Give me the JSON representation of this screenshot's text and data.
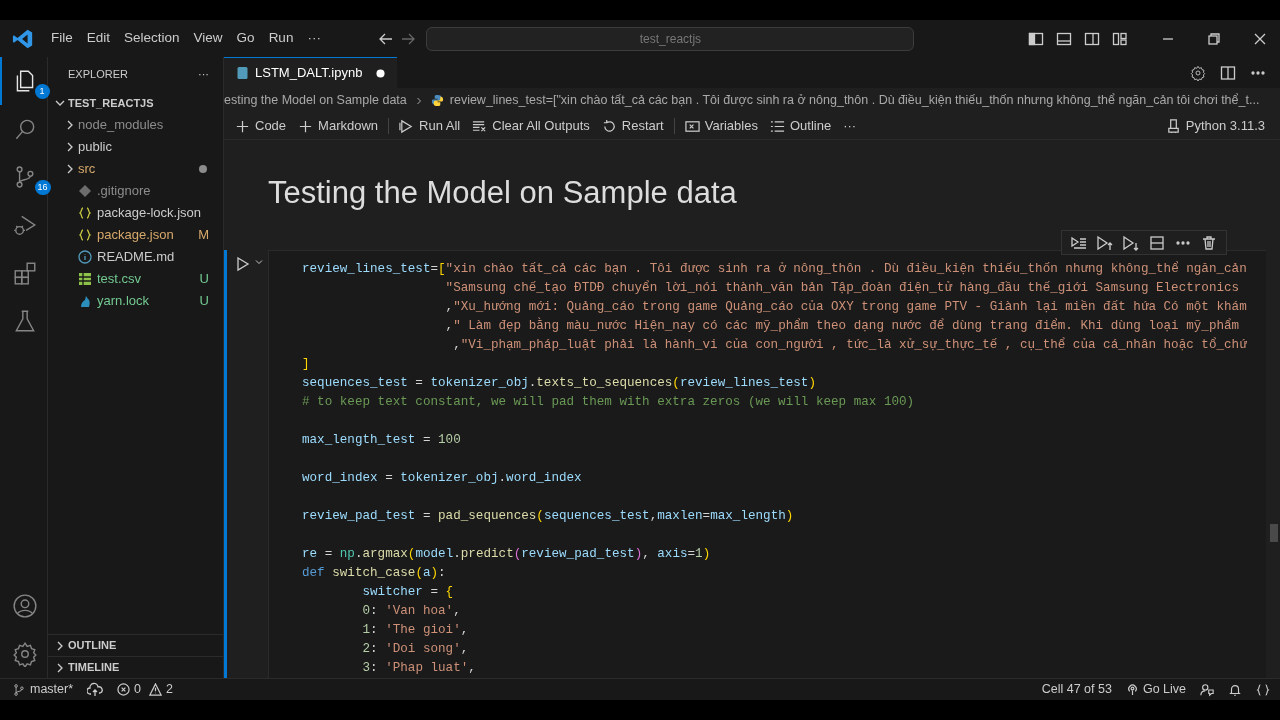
{
  "title_bar": {
    "menu": [
      "File",
      "Edit",
      "Selection",
      "View",
      "Go",
      "Run",
      "···"
    ],
    "command_center": "test_reactjs"
  },
  "activity_bar": {
    "items": [
      {
        "badge": "1",
        "selected": true
      },
      {
        "selected": false
      },
      {
        "badge": "16",
        "selected": false
      },
      {
        "selected": false
      },
      {
        "selected": false
      },
      {
        "selected": false
      }
    ]
  },
  "sidebar": {
    "title": "EXPLORER",
    "more": "···",
    "root": {
      "label": "TEST_REACTJS",
      "expanded": true,
      "children": [
        {
          "kind": "folder",
          "label": "node_modules",
          "expanded": false,
          "color": "#8c8c8c"
        },
        {
          "kind": "folder",
          "label": "public",
          "expanded": false,
          "color": "#cccccc"
        },
        {
          "kind": "folder",
          "label": "src",
          "expanded": false,
          "color": "#d7a96b",
          "status_dot": true
        },
        {
          "kind": "ignore",
          "label": ".gitignore",
          "color": "#8c8c8c"
        },
        {
          "kind": "json",
          "label": "package-lock.json",
          "color": "#cccccc"
        },
        {
          "kind": "json",
          "label": "package.json",
          "color": "#d7a96b",
          "status": "M"
        },
        {
          "kind": "info",
          "label": "README.md",
          "color": "#cccccc"
        },
        {
          "kind": "table",
          "label": "test.csv",
          "color": "#73c991",
          "status": "U"
        },
        {
          "kind": "lock",
          "label": "yarn.lock",
          "color": "#73c991",
          "status": "U"
        }
      ]
    },
    "sections": [
      {
        "label": "OUTLINE",
        "expanded": false
      },
      {
        "label": "TIMELINE",
        "expanded": false
      }
    ]
  },
  "editor": {
    "tabs": [
      {
        "label": "LSTM_DALT.ipynb",
        "selected": true,
        "dirty": true
      }
    ],
    "breadcrumb": [
      "esting the Model on Sample data",
      "review_lines_test=[\"xin chào tất_cả các bạn . Tôi được sinh ra ở nông_thôn . Dù điều_kiện thiếu_thốn nhưng không_thể ngăn_cản tôi chơi thể_t..."
    ],
    "toolbar": [
      {
        "kind": "add",
        "label": "Code"
      },
      {
        "kind": "add",
        "label": "Markdown",
        "separator_after": true
      },
      {
        "kind": "run",
        "label": "Run All"
      },
      {
        "kind": "clear",
        "label": "Clear All Outputs"
      },
      {
        "kind": "restart",
        "label": "Restart",
        "separator_after": true
      },
      {
        "kind": "variables",
        "label": "Variables"
      },
      {
        "kind": "outline",
        "label": "Outline"
      },
      {
        "kind": "more",
        "label": "···"
      }
    ],
    "kernel": "Python 3.11.3",
    "heading": "Testing the Model on Sample data",
    "cell": {
      "focused": true,
      "lines": [
        {
          "kind": "code",
          "tokens": [
            {
              "kind": "var",
              "text": "review_lines_test"
            },
            {
              "kind": "plain",
              "text": "="
            },
            {
              "kind": "bracket",
              "text": "["
            },
            {
              "kind": "str",
              "text": "\"xin chào tất_cả các bạn . Tôi được sinh ra ở nông_thôn . Dù điều_kiện thiếu_thốn nhưng không_thể ngăn_cản"
            }
          ]
        },
        {
          "kind": "code",
          "tokens": [
            {
              "kind": "str",
              "text": "                   \"Samsung chế_tạo ĐTDĐ chuyển lời_nói thành_văn bản Tập_đoàn điện_tử hàng_đầu thế_giới Samsung Electronics"
            }
          ]
        },
        {
          "kind": "code",
          "tokens": [
            {
              "kind": "plain",
              "text": "                   ,"
            },
            {
              "kind": "str",
              "text": "\"Xu_hướng mới: Quảng_cáo trong game Quảng_cáo của OXY trong game PTV - Giành lại miền đất hứa Có một khám"
            }
          ]
        },
        {
          "kind": "code",
          "tokens": [
            {
              "kind": "plain",
              "text": "                   ,"
            },
            {
              "kind": "str",
              "text": "\" Làm đẹp bằng màu_nước Hiện_nay có các mỹ_phẩm theo dạng nước để dùng trang điểm. Khi dùng loại mỹ_phẩm"
            }
          ]
        },
        {
          "kind": "code",
          "tokens": [
            {
              "kind": "plain",
              "text": "                    ,"
            },
            {
              "kind": "str",
              "text": "\"Vi_phạm_pháp_luật phải là hành_vi của con_người , tức_là xử_sự_thực_tế , cụ_thể của cá_nhân hoặc tổ_chứ"
            }
          ]
        },
        {
          "kind": "code",
          "tokens": [
            {
              "kind": "bracket",
              "text": "]"
            }
          ]
        },
        {
          "kind": "code",
          "tokens": [
            {
              "kind": "var",
              "text": "sequences_test"
            },
            {
              "kind": "plain",
              "text": " = "
            },
            {
              "kind": "var",
              "text": "tokenizer_obj"
            },
            {
              "kind": "plain",
              "text": "."
            },
            {
              "kind": "fn",
              "text": "texts_to_sequences"
            },
            {
              "kind": "bracket",
              "text": "("
            },
            {
              "kind": "var",
              "text": "review_lines_test"
            },
            {
              "kind": "bracket",
              "text": ")"
            }
          ]
        },
        {
          "kind": "code",
          "tokens": [
            {
              "kind": "comment",
              "text": "# to keep text constant, we will pad them with extra zeros (we will keep max 100)"
            }
          ]
        },
        {
          "kind": "blank"
        },
        {
          "kind": "code",
          "tokens": [
            {
              "kind": "var",
              "text": "max_length_test"
            },
            {
              "kind": "plain",
              "text": " = "
            },
            {
              "kind": "num",
              "text": "100"
            }
          ]
        },
        {
          "kind": "blank"
        },
        {
          "kind": "code",
          "tokens": [
            {
              "kind": "var",
              "text": "word_index"
            },
            {
              "kind": "plain",
              "text": " = "
            },
            {
              "kind": "var",
              "text": "tokenizer_obj"
            },
            {
              "kind": "plain",
              "text": "."
            },
            {
              "kind": "var",
              "text": "word_index"
            }
          ]
        },
        {
          "kind": "blank"
        },
        {
          "kind": "code",
          "tokens": [
            {
              "kind": "var",
              "text": "review_pad_test"
            },
            {
              "kind": "plain",
              "text": " = "
            },
            {
              "kind": "fn",
              "text": "pad_sequences"
            },
            {
              "kind": "bracket",
              "text": "("
            },
            {
              "kind": "var",
              "text": "sequences_test"
            },
            {
              "kind": "plain",
              "text": ","
            },
            {
              "kind": "var",
              "text": "maxlen"
            },
            {
              "kind": "plain",
              "text": "="
            },
            {
              "kind": "var",
              "text": "max_length"
            },
            {
              "kind": "bracket",
              "text": ")"
            }
          ]
        },
        {
          "kind": "blank"
        },
        {
          "kind": "code",
          "tokens": [
            {
              "kind": "var",
              "text": "re"
            },
            {
              "kind": "plain",
              "text": " = "
            },
            {
              "kind": "type",
              "text": "np"
            },
            {
              "kind": "plain",
              "text": "."
            },
            {
              "kind": "fn",
              "text": "argmax"
            },
            {
              "kind": "bracket",
              "text": "("
            },
            {
              "kind": "var",
              "text": "model"
            },
            {
              "kind": "plain",
              "text": "."
            },
            {
              "kind": "fn",
              "text": "predict"
            },
            {
              "kind": "paren",
              "text": "("
            },
            {
              "kind": "var",
              "text": "review_pad_test"
            },
            {
              "kind": "paren",
              "text": ")"
            },
            {
              "kind": "plain",
              "text": ", "
            },
            {
              "kind": "var",
              "text": "axis"
            },
            {
              "kind": "plain",
              "text": "="
            },
            {
              "kind": "num",
              "text": "1"
            },
            {
              "kind": "bracket",
              "text": ")"
            }
          ]
        },
        {
          "kind": "code",
          "tokens": [
            {
              "kind": "keyword",
              "text": "def"
            },
            {
              "kind": "fn",
              "text": " switch_case"
            },
            {
              "kind": "bracket",
              "text": "("
            },
            {
              "kind": "var",
              "text": "a"
            },
            {
              "kind": "bracket",
              "text": ")"
            },
            {
              "kind": "plain",
              "text": ":"
            }
          ]
        },
        {
          "kind": "code",
          "tokens": [
            {
              "kind": "var",
              "text": "        switcher"
            },
            {
              "kind": "plain",
              "text": " = "
            },
            {
              "kind": "bracket",
              "text": "{"
            }
          ]
        },
        {
          "kind": "code",
          "tokens": [
            {
              "kind": "num",
              "text": "        0"
            },
            {
              "kind": "plain",
              "text": ": "
            },
            {
              "kind": "str",
              "text": "'Van hoa'"
            },
            {
              "kind": "plain",
              "text": ","
            }
          ]
        },
        {
          "kind": "code",
          "tokens": [
            {
              "kind": "num",
              "text": "        1"
            },
            {
              "kind": "plain",
              "text": ": "
            },
            {
              "kind": "str",
              "text": "'The gioi'"
            },
            {
              "kind": "plain",
              "text": ","
            }
          ]
        },
        {
          "kind": "code",
          "tokens": [
            {
              "kind": "num",
              "text": "        2"
            },
            {
              "kind": "plain",
              "text": ": "
            },
            {
              "kind": "str",
              "text": "'Doi song'"
            },
            {
              "kind": "plain",
              "text": ","
            }
          ]
        },
        {
          "kind": "code",
          "tokens": [
            {
              "kind": "num",
              "text": "        3"
            },
            {
              "kind": "plain",
              "text": ": "
            },
            {
              "kind": "str",
              "text": "'Phap luat'"
            },
            {
              "kind": "plain",
              "text": ","
            }
          ]
        }
      ]
    }
  },
  "status_bar": {
    "branch": "master*",
    "errors": "0",
    "warnings": "2",
    "cell_position": "Cell 47 of 53",
    "go_live": "Go Live"
  }
}
